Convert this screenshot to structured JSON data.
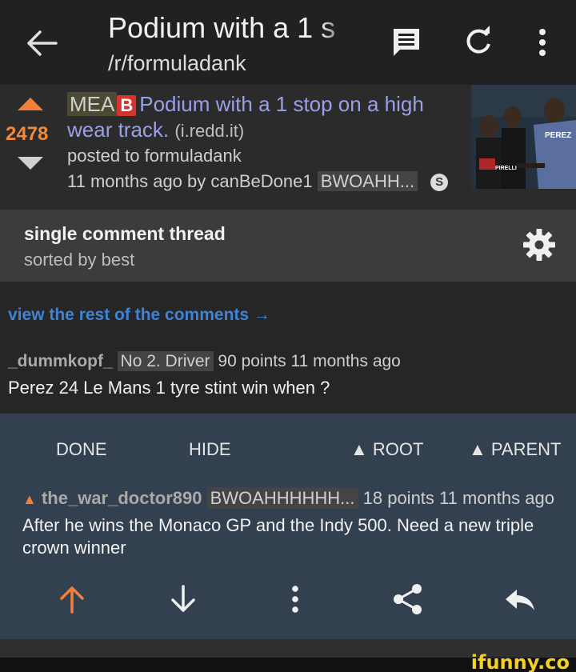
{
  "app_bar": {
    "title": "Podium with a 1 s",
    "subreddit": "/r/formuladank"
  },
  "post": {
    "score": "2478",
    "flair": "MEA",
    "badge": "B",
    "title": "Podium with a 1 stop on a high wear track.",
    "domain": "(i.redd.it)",
    "posted_to": "posted to formuladank",
    "time_by": "11 months ago by canBeDone1",
    "user_flair": "BWOAHH...",
    "s_badge": "S",
    "thumb_text_1": "PEREZ",
    "thumb_text_2": "PIRELLI"
  },
  "thread": {
    "title": "single comment thread",
    "sort": "sorted by best"
  },
  "view_rest": "view the rest of the comments →",
  "comment1": {
    "author": "_dummkopf_",
    "flair": "No 2. Driver",
    "points": "90 points",
    "time": "11 months ago",
    "body": "Perez 24 Le Mans 1 tyre stint win when ?"
  },
  "actions": {
    "done": "DONE",
    "hide": "HIDE",
    "root": "▲ ROOT",
    "parent": "▲ PARENT"
  },
  "comment2": {
    "arrow": "▲",
    "author": "the_war_doctor890",
    "flair": "BWOAHHHHHH...",
    "points": "18 points",
    "time": "11 months ago",
    "body": "After he wins the Monaco GP and the Indy 500. Need a new triple crown winner"
  },
  "watermark": "ifunny.co",
  "colors": {
    "upvote": "#f2803a",
    "link": "#3f82d6",
    "title": "#9aa0e6",
    "panel": "#33404f"
  }
}
